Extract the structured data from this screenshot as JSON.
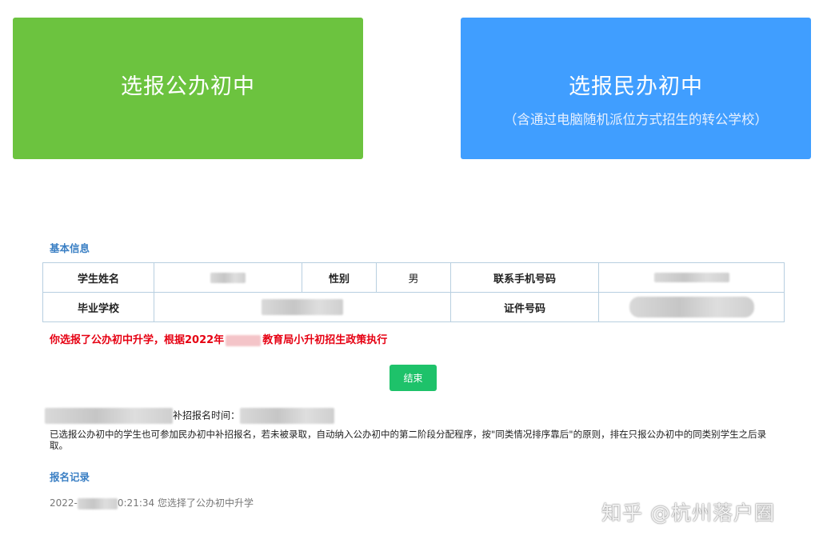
{
  "choices": {
    "public": {
      "title": "选报公办初中"
    },
    "private": {
      "title": "选报民办初中",
      "subtitle": "（含通过电脑随机派位方式招生的转公学校）"
    }
  },
  "basic_info": {
    "section_title": "基本信息",
    "labels": {
      "student_name": "学生姓名",
      "gender": "性别",
      "phone": "联系手机号码",
      "school": "毕业学校",
      "id_number": "证件号码"
    },
    "values": {
      "gender": "男"
    }
  },
  "notice": {
    "prefix": "你选报了公办初中升学，根据2022年",
    "suffix": "教育局小升初招生政策执行"
  },
  "end_button": "结束",
  "supplement": {
    "label": "补招报名时间："
  },
  "description": "已选报公办初中的学生也可参加民办初中补招报名，若未被录取，自动纳入公办初中的第二阶段分配程序，按\"同类情况排序靠后\"的原则，排在只报公办初中的同类别学生之后录取。",
  "record": {
    "section_title": "报名记录",
    "date_prefix": "2022-",
    "time_suffix": "0:21:34",
    "message": "您选择了公办初中升学"
  },
  "watermark": "知乎 @杭州落户圈",
  "colors": {
    "public_button": "#6cc33f",
    "private_button": "#409eff",
    "end_button": "#1ec26a",
    "notice": "#e60012",
    "section_title": "#3a7fc4"
  }
}
